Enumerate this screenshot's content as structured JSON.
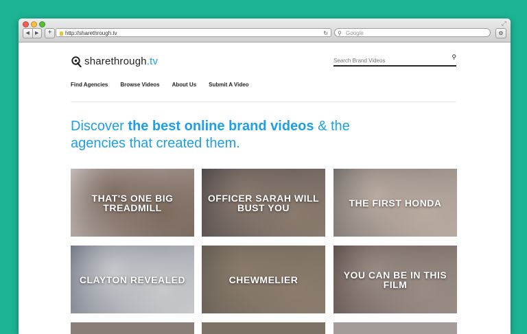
{
  "browser": {
    "url": "http://sharethrough.tv",
    "search_placeholder": "Google",
    "add_label": "+",
    "back_label": "◀",
    "forward_label": "▶"
  },
  "site": {
    "logo_name": "sharethrough",
    "logo_tld": ".tv",
    "search_placeholder": "Search Brand Videos",
    "nav": [
      "Find Agencies",
      "Browse Videos",
      "About Us",
      "Submit A Video"
    ]
  },
  "headline": {
    "part1": "Discover ",
    "bold": "the best online brand videos",
    "part2": " & the agencies that created them."
  },
  "videos": [
    {
      "title": "THAT'S ONE BIG TREADMILL",
      "color1": "#c9c2c0",
      "color2": "#7d6b60"
    },
    {
      "title": "OFFICER SARAH WILL BUST YOU",
      "color1": "#4a4548",
      "color2": "#8a7a6e"
    },
    {
      "title": "THE FIRST HONDA",
      "color1": "#6c6a66",
      "color2": "#b9aaa0"
    },
    {
      "title": "CLAYTON REVEALED",
      "color1": "#6b7180",
      "color2": "#c7c9cc"
    },
    {
      "title": "CHEWMELIER",
      "color1": "#5f5a52",
      "color2": "#8b7c6c"
    },
    {
      "title": "YOU CAN BE IN THIS FILM",
      "color1": "#5a4a48",
      "color2": "#9a8c85"
    }
  ],
  "colors": {
    "accent": "#1e9fe6",
    "background": "#1cb494"
  }
}
